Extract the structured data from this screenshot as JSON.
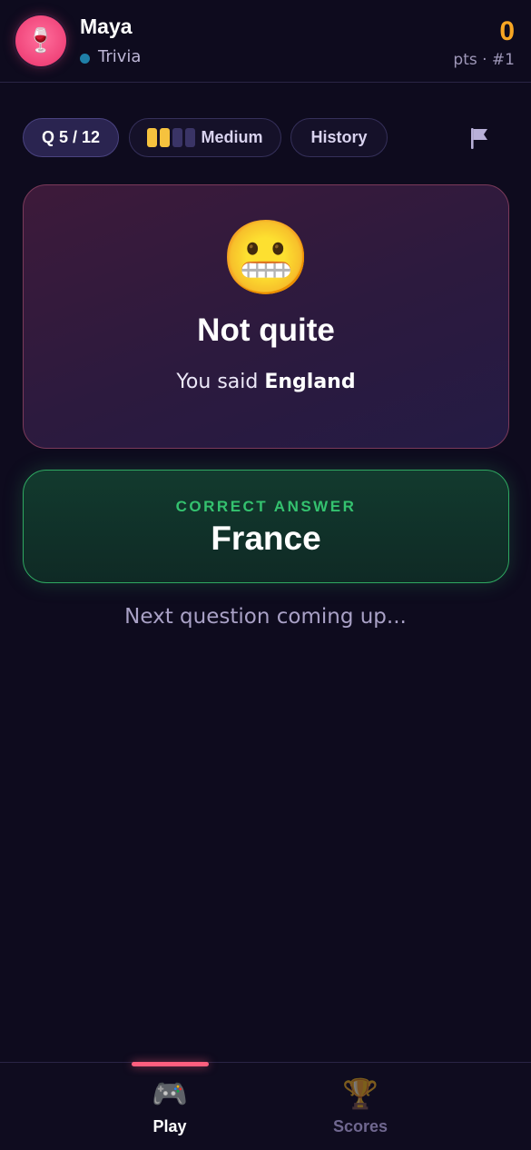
{
  "header": {
    "avatar_emoji": "🍷",
    "user_name": "Maya",
    "status_text": "Trivia",
    "score": "0",
    "rank_text": "pts · #1"
  },
  "pills": {
    "question": "Q 5 / 12",
    "difficulty_label": "Medium",
    "difficulty_level": 2,
    "difficulty_max": 4,
    "history_label": "History"
  },
  "result": {
    "emoji": "😬",
    "title": "Not quite",
    "you_said_prefix": "You said",
    "you_said_answer": "England"
  },
  "answer": {
    "label": "CORRECT ANSWER",
    "value": "France"
  },
  "next_message": "Next question coming up...",
  "nav": {
    "play_icon": "🎮",
    "play_label": "Play",
    "scores_icon": "🏆",
    "scores_label": "Scores",
    "active": "play"
  },
  "colors": {
    "background": "#0e0b1e",
    "score": "#f7a623",
    "correct": "#34c26f",
    "accent": "#ff5f7e",
    "difficulty_on": "#f6c23e"
  }
}
